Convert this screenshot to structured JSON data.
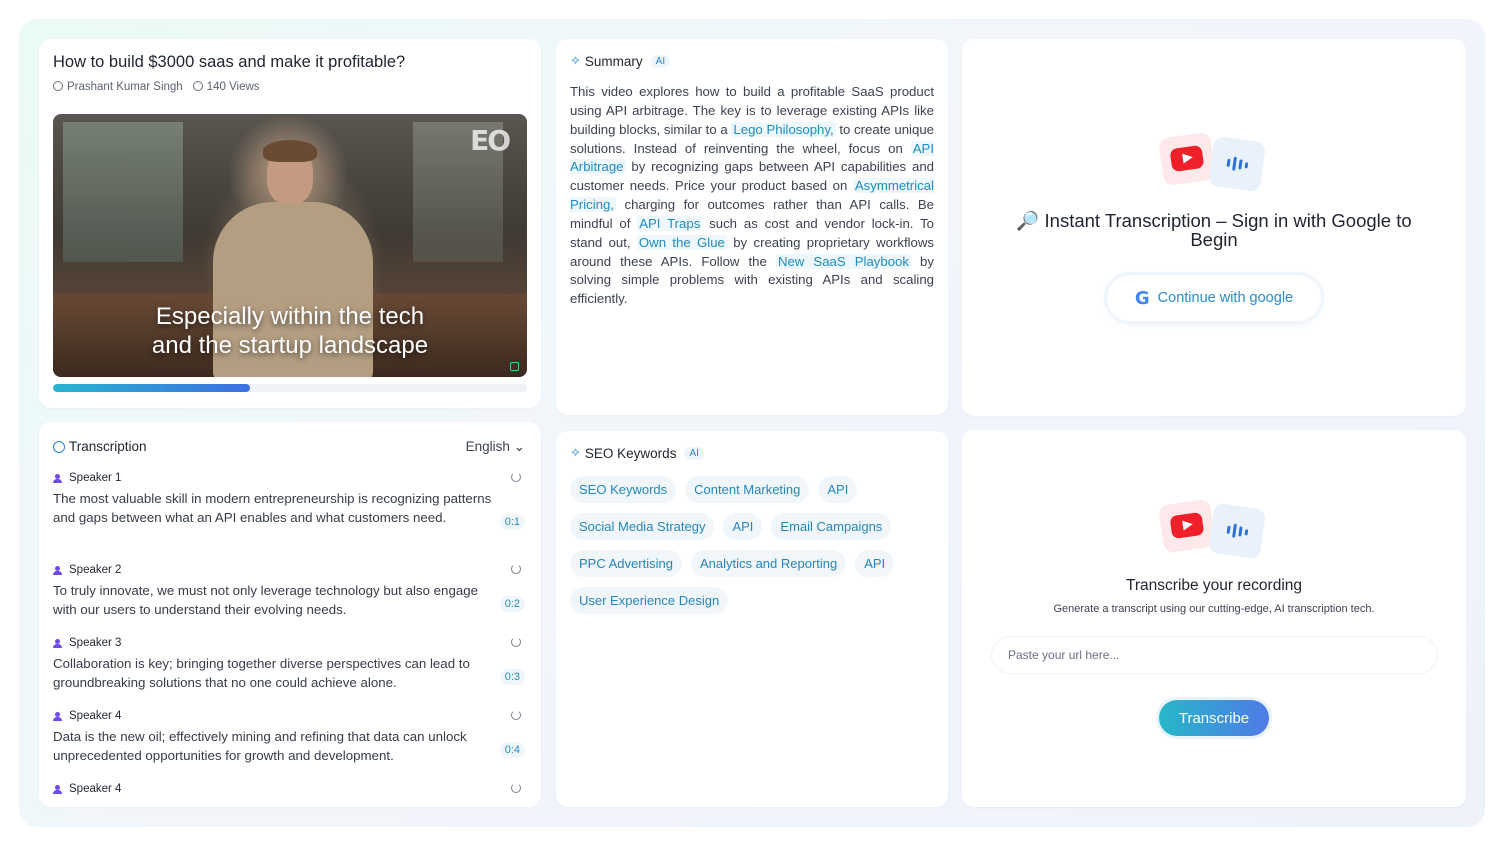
{
  "video": {
    "title": "How to build $3000 saas and make it profitable?",
    "author": "Prashant Kumar Singh",
    "views": "140 Views",
    "caption_line1": "Especially within the tech",
    "caption_line2": "and the startup landscape",
    "channel_logo": "EO",
    "progress_percent": 41.5
  },
  "transcription": {
    "heading": "Transcription",
    "language": "English",
    "segments": [
      {
        "speaker": "Speaker 1",
        "text": "The most valuable skill in modern entrepreneurship is recognizing patterns and gaps between what an API enables and what customers need.",
        "time": "0:1"
      },
      {
        "speaker": "Speaker 2",
        "text": "To truly innovate, we must not only leverage technology but also engage with our users to understand their evolving needs.",
        "time": "0:2"
      },
      {
        "speaker": "Speaker 3",
        "text": "Collaboration is key; bringing together diverse perspectives can lead to groundbreaking solutions that no one could achieve alone.",
        "time": "0:3"
      },
      {
        "speaker": "Speaker 4",
        "text": "Data is the new oil; effectively mining and refining that data can unlock unprecedented opportunities for growth and development.",
        "time": "0:4"
      },
      {
        "speaker": "Speaker 4",
        "text": "",
        "time": ""
      }
    ]
  },
  "summary": {
    "heading": "Summary",
    "badge": "AI",
    "parts": [
      {
        "t": "This video explores how to build a profitable SaaS product using API arbitrage. The key is to leverage existing APIs like building blocks, similar to a ",
        "h": false
      },
      {
        "t": "Lego Philosophy,",
        "h": true
      },
      {
        "t": " to create unique solutions. Instead of reinventing the wheel, focus on ",
        "h": false
      },
      {
        "t": "API Arbitrage",
        "h": true
      },
      {
        "t": " by recognizing gaps between API capabilities and customer needs. Price your product based on ",
        "h": false
      },
      {
        "t": "Asymmetrical Pricing,",
        "h": true
      },
      {
        "t": " charging for outcomes rather than API calls. Be mindful of ",
        "h": false
      },
      {
        "t": "API Traps",
        "h": true
      },
      {
        "t": " such as cost and vendor lock-in. To stand out, ",
        "h": false
      },
      {
        "t": "Own the Glue",
        "h": true
      },
      {
        "t": " by creating proprietary workflows around these APIs. Follow the ",
        "h": false
      },
      {
        "t": "New SaaS Playbook",
        "h": true
      },
      {
        "t": " by solving simple problems with existing APIs and scaling efficiently.",
        "h": false
      }
    ]
  },
  "seo": {
    "heading": "SEO Keywords",
    "badge": "AI",
    "keywords": [
      "SEO Keywords",
      "Content Marketing",
      "API",
      "Social Media Strategy",
      "API",
      "Email Campaigns",
      "PPC Advertising",
      "Analytics and Reporting",
      "API",
      "User Experience Design"
    ]
  },
  "signin": {
    "title": "🔎 Instant Transcription – Sign in with Google to Begin",
    "button_label": "Continue with google"
  },
  "transcribe": {
    "title": "Transcribe your recording",
    "subtitle": "Generate a transcript using our cutting-edge, AI transcription tech.",
    "input_placeholder": "Paste your url here...",
    "input_value": "",
    "button_label": "Transcribe"
  },
  "icons": {
    "author": "user-circle-icon",
    "views": "eye-icon",
    "summary": "sparkle-icon",
    "speaker": "person-icon",
    "refresh": "refresh-icon",
    "youtube": "youtube-icon",
    "audio": "audio-wave-icon",
    "google": "google-icon"
  },
  "colors": {
    "accent": "#2a8bc8",
    "speaker_icon": "#6c4be8",
    "youtube_red": "#f0202a",
    "button_gradient_start": "#27b7c9",
    "button_gradient_end": "#4f7ae6"
  }
}
